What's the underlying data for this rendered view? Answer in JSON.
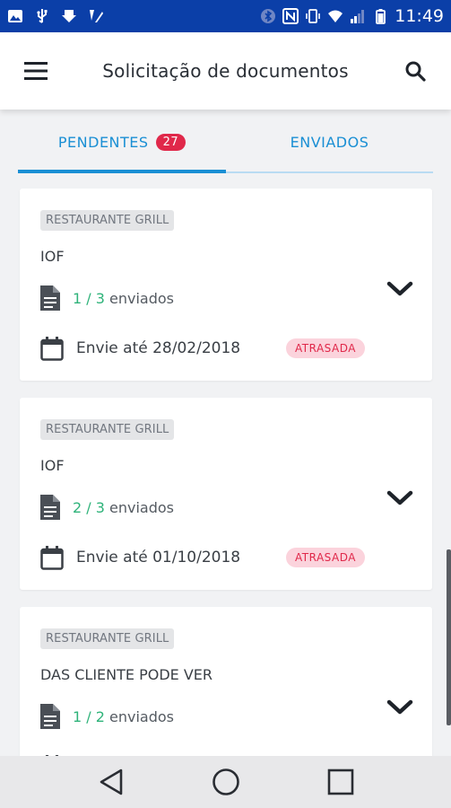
{
  "status_bar": {
    "time": "11:49",
    "icons": [
      "image-icon",
      "usb-icon",
      "download-icon",
      "pen-icon",
      "bluetooth-icon",
      "nfc-icon",
      "vibrate-icon",
      "wifi-icon",
      "signal-icon",
      "battery-icon"
    ]
  },
  "header": {
    "title": "Solicitação de documentos",
    "menu_icon": "menu-icon",
    "search_icon": "search-icon"
  },
  "tabs": [
    {
      "label": "PENDENTES",
      "badge": "27",
      "active": true
    },
    {
      "label": "ENVIADOS",
      "active": false
    }
  ],
  "cards": [
    {
      "company": "RESTAURANTE GRILL",
      "document": "IOF",
      "sent": "1 / 3",
      "sent_label": "enviados",
      "due": "Envie até 28/02/2018",
      "status": "ATRASADA"
    },
    {
      "company": "RESTAURANTE GRILL",
      "document": "IOF",
      "sent": "2 / 3",
      "sent_label": "enviados",
      "due": "Envie até 01/10/2018",
      "status": "ATRASADA"
    },
    {
      "company": "RESTAURANTE GRILL",
      "document": "DAS CLIENTE PODE VER",
      "sent": "1 / 2",
      "sent_label": "enviados"
    }
  ],
  "colors": {
    "status_bar": "#0b3fa8",
    "accent": "#1a8fd4",
    "badge": "#e0284a",
    "sent_count": "#2fb37a",
    "late_bg": "#fbd3dc"
  },
  "nav_bar": {
    "icons": [
      "back-icon",
      "home-icon",
      "recents-icon"
    ]
  }
}
